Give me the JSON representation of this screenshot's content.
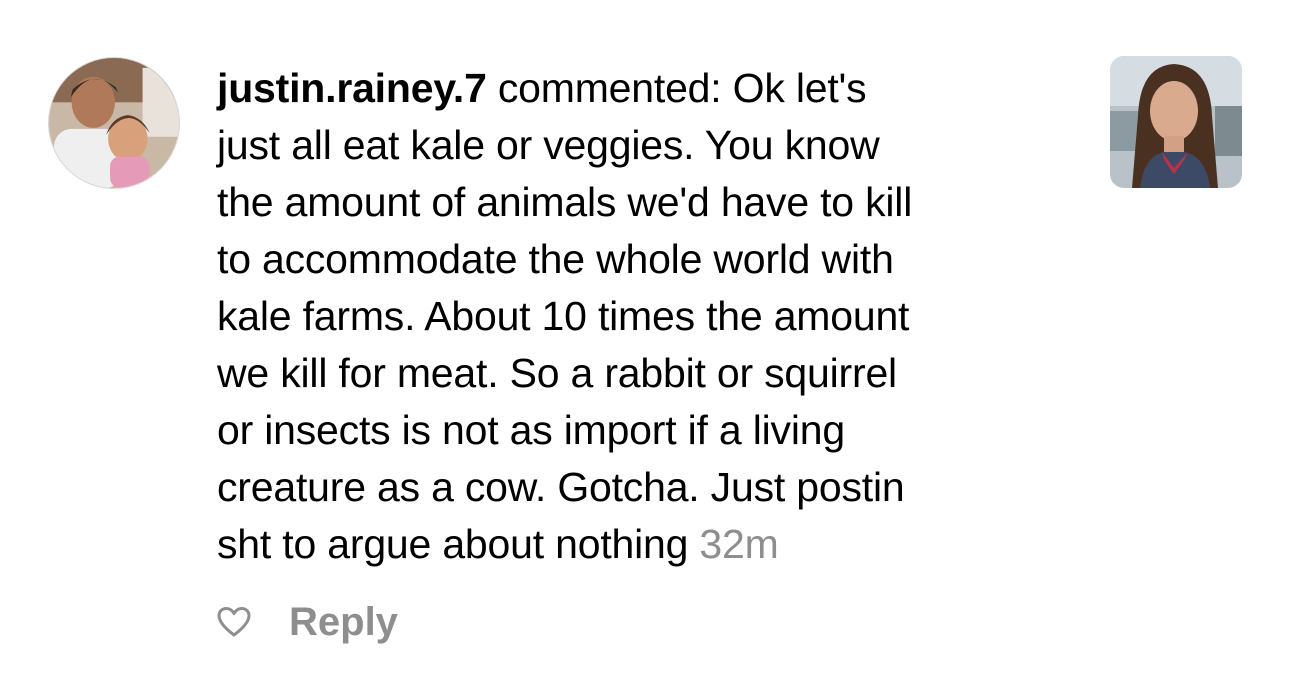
{
  "comment": {
    "username": "justin.rainey.7",
    "action_text": " commented: ",
    "body": "Ok let's\njust all eat kale or veggies. You know\nthe amount of animals we'd have to kill\nto accommodate the whole world with\nkale farms. About 10 times the amount\nwe kill for meat. So a rabbit or squirrel\nor insects is not as import if a living\ncreature as a cow. Gotcha. Just postin\nsht to argue about nothing ",
    "timestamp": "32m"
  },
  "actions": {
    "like_icon": "heart-outline-icon",
    "reply_label": "Reply"
  },
  "colors": {
    "text": "#000000",
    "secondary": "#8e8e8e",
    "background": "#ffffff"
  }
}
